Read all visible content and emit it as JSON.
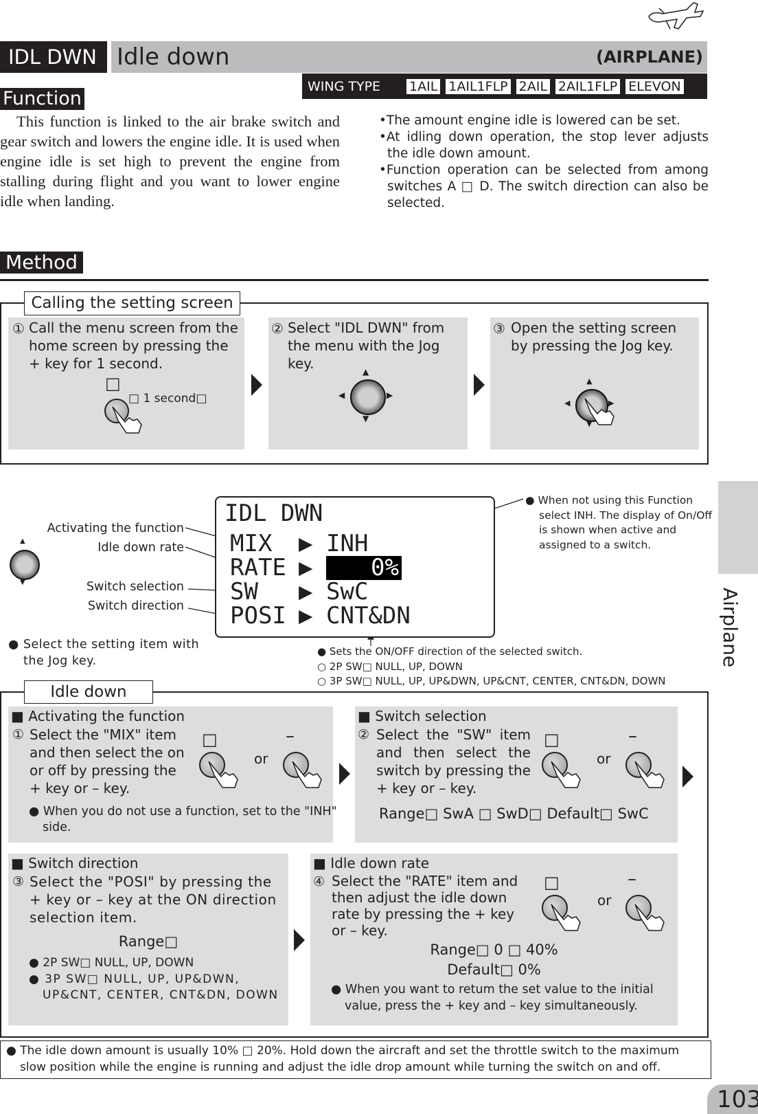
{
  "header": {
    "code": "IDL DWN",
    "title": "Idle down",
    "category": "(AIRPLANE)",
    "wing_type_label": "WING TYPE",
    "wing_types": [
      "1AIL",
      "1AIL1FLP",
      "2AIL",
      "2AIL1FLP",
      "ELEVON"
    ]
  },
  "function": {
    "heading": "Function",
    "description": "This function is linked to the air brake switch and gear switch and lowers the engine idle. It is used when engine idle is set high to prevent the engine from stalling during flight and you want to lower engine idle when landing.",
    "bullets": [
      "•The amount engine idle is lowered can be set.",
      "•At idling down operation, the stop lever adjusts the idle down amount.",
      "•Function operation can be selected from among switches A □ D. The switch direction can also be selected."
    ]
  },
  "method": {
    "heading": "Method",
    "calling": {
      "title": "Calling the setting screen",
      "steps": [
        {
          "num": "①",
          "text": "Call the menu screen from the home screen by pressing the + key for 1 second.",
          "key_label": "□",
          "hold_label": "□ 1 second□"
        },
        {
          "num": "②",
          "text": "Select \"IDL DWN\" from the menu with the Jog key."
        },
        {
          "num": "③",
          "text": "Open the setting screen by pressing the Jog key."
        }
      ]
    },
    "screen": {
      "lcd_title": "IDL DWN",
      "rows": [
        {
          "item": "MIX",
          "value": "INH"
        },
        {
          "item": "RATE",
          "value": "0%"
        },
        {
          "item": "SW",
          "value": "SwC"
        },
        {
          "item": "POSI",
          "value": "CNT&DN"
        }
      ],
      "labels": [
        "Activating the function",
        "Idle down rate",
        "Switch selection",
        "Switch direction"
      ],
      "select_note": "● Select the setting item with the Jog key.",
      "inh_note": "● When not using this Function select INH. The display of On/Off is shown when active and assigned to a switch.",
      "direction_notes": [
        "● Sets the ON/OFF direction of the selected switch.",
        "○ 2P SW□ NULL, UP, DOWN",
        "○ 3P SW□ NULL, UP, UP&DWN, UP&CNT, CENTER, CNT&DN, DOWN"
      ]
    },
    "idle_down": {
      "title": "Idle down",
      "or_label": "or",
      "plus_label": "□",
      "minus_label": "–",
      "activating": {
        "heading": "■ Activating the function",
        "num": "①",
        "text": "Select the \"MIX\" item and then select the on or off by pressing the + key or – key.",
        "note": "● When you do not use a function, set to the \"INH\" side."
      },
      "switch_selection": {
        "heading": "■ Switch selection",
        "num": "②",
        "text": "Select the \"SW\" item and then select the switch by pressing the + key or – key.",
        "range": "Range□ SwA □ SwD□ Default□ SwC"
      },
      "switch_direction": {
        "heading": "■ Switch direction",
        "num": "③",
        "text": "Select the \"POSI\" by pressing the + key or – key at the ON direction selection item.",
        "range_label": "Range□",
        "ranges": [
          "● 2P SW□ NULL, UP, DOWN",
          "● 3P SW□ NULL, UP, UP&DWN, UP&CNT, CENTER, CNT&DN, DOWN"
        ]
      },
      "rate": {
        "heading": "■ Idle down rate",
        "num": "④",
        "text": "Select the \"RATE\" item and then adjust the idle down rate by pressing the + key or – key.",
        "range": "Range□ 0 □ 40%",
        "default": "Default□ 0%",
        "note": "● When you want to retum the set value to the initial value, press the + key and – key simultaneously."
      }
    },
    "footer_note": "● The idle down amount is usually 10% □ 20%. Hold down the aircraft and set the throttle switch to the maximum slow position while the engine is running and adjust the idle drop amount while turning the switch on and off."
  },
  "side_tab": "Airplane",
  "page_number": "103"
}
